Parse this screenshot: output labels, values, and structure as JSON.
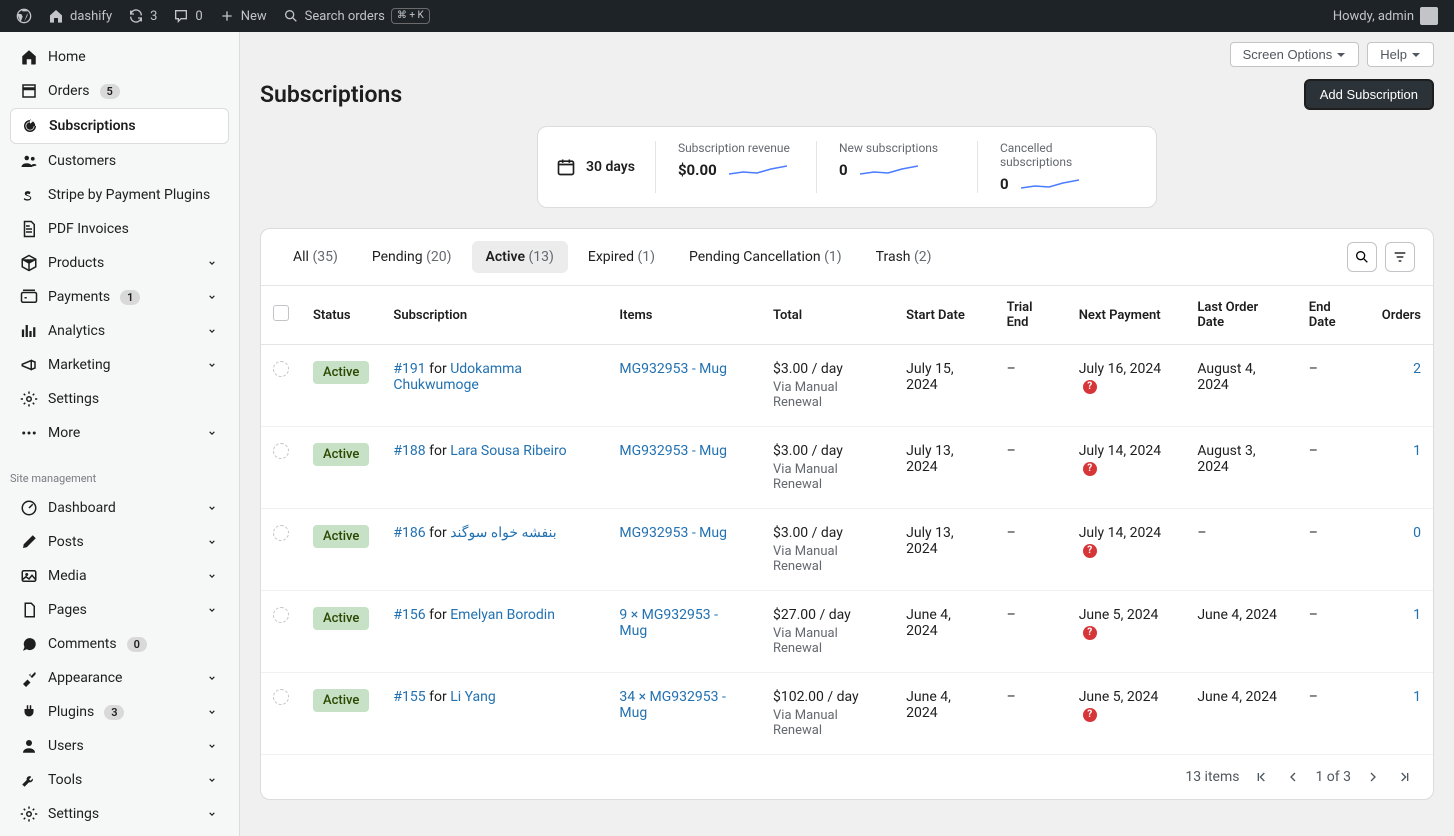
{
  "adminbar": {
    "site_name": "dashify",
    "updates": "3",
    "comments": "0",
    "new_label": "New",
    "search_label": "Search orders",
    "search_kbd": "⌘ + K",
    "howdy": "Howdy, admin"
  },
  "sidebar": {
    "main": [
      {
        "label": "Home",
        "icon": "home"
      },
      {
        "label": "Orders",
        "icon": "orders",
        "badge": "5"
      },
      {
        "label": "Subscriptions",
        "icon": "subscriptions",
        "current": true
      },
      {
        "label": "Customers",
        "icon": "customers"
      },
      {
        "label": "Stripe by Payment Plugins",
        "icon": "stripe"
      },
      {
        "label": "PDF Invoices",
        "icon": "pdf"
      },
      {
        "label": "Products",
        "icon": "products",
        "expandable": true
      },
      {
        "label": "Payments",
        "icon": "payments",
        "badge": "1",
        "expandable": true
      },
      {
        "label": "Analytics",
        "icon": "analytics",
        "expandable": true
      },
      {
        "label": "Marketing",
        "icon": "marketing",
        "expandable": true
      },
      {
        "label": "Settings",
        "icon": "settings"
      },
      {
        "label": "More",
        "icon": "more",
        "expandable": true
      }
    ],
    "section_label": "Site management",
    "site": [
      {
        "label": "Dashboard",
        "icon": "dashboard",
        "expandable": true
      },
      {
        "label": "Posts",
        "icon": "posts",
        "expandable": true
      },
      {
        "label": "Media",
        "icon": "media",
        "expandable": true
      },
      {
        "label": "Pages",
        "icon": "pages",
        "expandable": true
      },
      {
        "label": "Comments",
        "icon": "comments",
        "badge": "0"
      },
      {
        "label": "Appearance",
        "icon": "appearance",
        "expandable": true
      },
      {
        "label": "Plugins",
        "icon": "plugins",
        "badge": "3",
        "expandable": true
      },
      {
        "label": "Users",
        "icon": "users",
        "expandable": true
      },
      {
        "label": "Tools",
        "icon": "tools",
        "expandable": true
      },
      {
        "label": "Settings",
        "icon": "settings2",
        "expandable": true
      }
    ]
  },
  "topopts": {
    "screen_options": "Screen Options",
    "help": "Help"
  },
  "header": {
    "title": "Subscriptions",
    "add_label": "Add Subscription"
  },
  "stats": {
    "range": "30 days",
    "items": [
      {
        "label": "Subscription revenue",
        "value": "$0.00"
      },
      {
        "label": "New subscriptions",
        "value": "0"
      },
      {
        "label": "Cancelled subscriptions",
        "value": "0"
      }
    ]
  },
  "tabs": [
    {
      "label": "All",
      "count": "(35)"
    },
    {
      "label": "Pending",
      "count": "(20)"
    },
    {
      "label": "Active",
      "count": "(13)",
      "active": true
    },
    {
      "label": "Expired",
      "count": "(1)"
    },
    {
      "label": "Pending Cancellation",
      "count": "(1)"
    },
    {
      "label": "Trash",
      "count": "(2)"
    }
  ],
  "columns": {
    "status": "Status",
    "subscription": "Subscription",
    "items": "Items",
    "total": "Total",
    "start_date": "Start Date",
    "trial_end": "Trial End",
    "next_payment": "Next Payment",
    "last_order_date": "Last Order Date",
    "end_date": "End Date",
    "orders": "Orders"
  },
  "rows": [
    {
      "status": "Active",
      "sub_id": "#191",
      "sub_for": "for",
      "sub_customer": "Udokamma Chukwumoge",
      "item": "MG932953 - Mug",
      "total": "$3.00 / day",
      "total_note": "Via Manual Renewal",
      "start": "July 15, 2024",
      "trial": "–",
      "next": "July 16, 2024",
      "next_warn": true,
      "last": "August 4, 2024",
      "end": "–",
      "orders": "2"
    },
    {
      "status": "Active",
      "sub_id": "#188",
      "sub_for": "for",
      "sub_customer": "Lara Sousa Ribeiro",
      "item": "MG932953 - Mug",
      "total": "$3.00 / day",
      "total_note": "Via Manual Renewal",
      "start": "July 13, 2024",
      "trial": "–",
      "next": "July 14, 2024",
      "next_warn": true,
      "last": "August 3, 2024",
      "end": "–",
      "orders": "1"
    },
    {
      "status": "Active",
      "sub_id": "#186",
      "sub_for": "for",
      "sub_customer": "بنفشه خواه سوگند",
      "item": "MG932953 - Mug",
      "total": "$3.00 / day",
      "total_note": "Via Manual Renewal",
      "start": "July 13, 2024",
      "trial": "–",
      "next": "July 14, 2024",
      "next_warn": true,
      "last": "–",
      "end": "–",
      "orders": "0"
    },
    {
      "status": "Active",
      "sub_id": "#156",
      "sub_for": "for",
      "sub_customer": "Emelyan Borodin",
      "item": "9 × MG932953 - Mug",
      "total": "$27.00 / day",
      "total_note": "Via Manual Renewal",
      "start": "June 4, 2024",
      "trial": "–",
      "next": "June 5, 2024",
      "next_warn": true,
      "last": "June 4, 2024",
      "end": "–",
      "orders": "1"
    },
    {
      "status": "Active",
      "sub_id": "#155",
      "sub_for": "for",
      "sub_customer": "Li Yang",
      "item": "34 × MG932953 - Mug",
      "total": "$102.00 / day",
      "total_note": "Via Manual Renewal",
      "start": "June 4, 2024",
      "trial": "–",
      "next": "June 5, 2024",
      "next_warn": true,
      "last": "June 4, 2024",
      "end": "–",
      "orders": "1"
    }
  ],
  "pagination": {
    "total": "13 items",
    "page_of": "1 of 3"
  }
}
